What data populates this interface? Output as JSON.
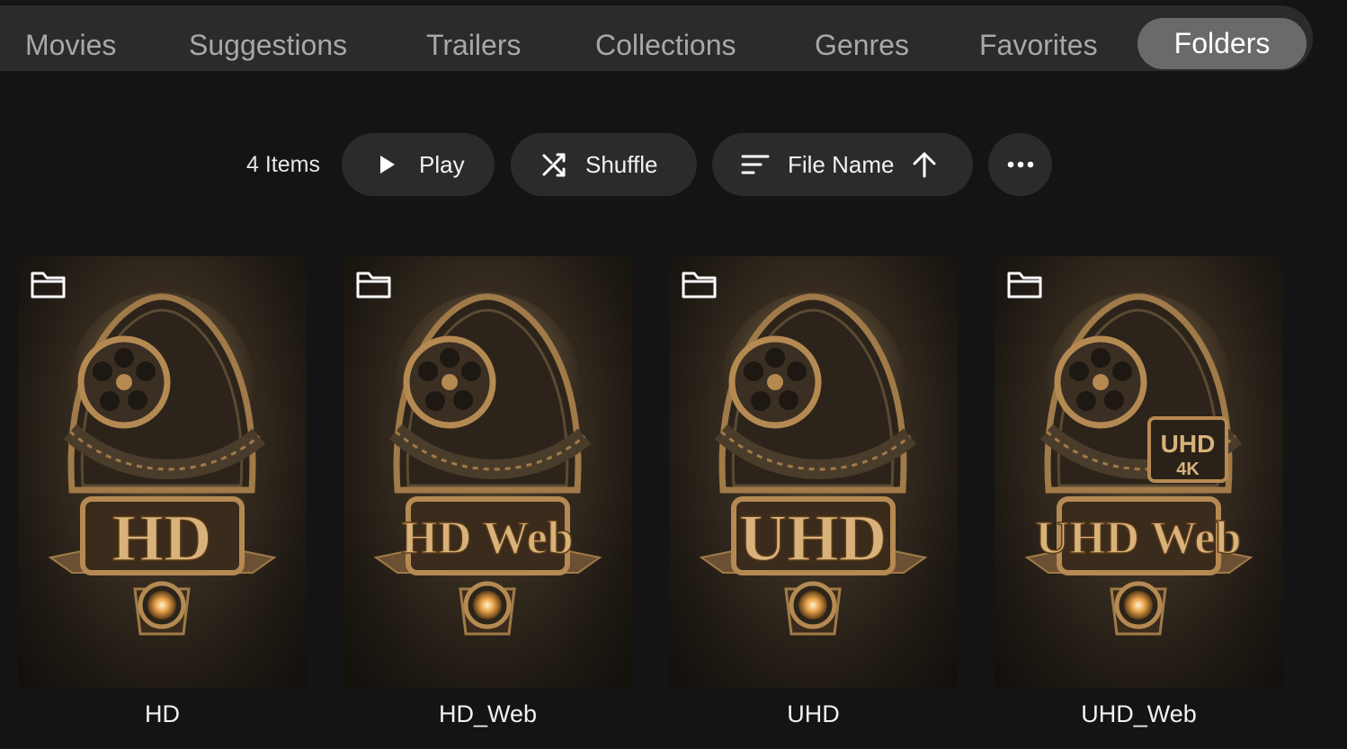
{
  "tabs": [
    {
      "label": "Movies",
      "active": false
    },
    {
      "label": "Suggestions",
      "active": false
    },
    {
      "label": "Trailers",
      "active": false
    },
    {
      "label": "Collections",
      "active": false
    },
    {
      "label": "Genres",
      "active": false
    },
    {
      "label": "Favorites",
      "active": false
    },
    {
      "label": "Folders",
      "active": true
    }
  ],
  "toolbar": {
    "item_count": "4 Items",
    "play_label": "Play",
    "play_icon": "play-icon",
    "shuffle_label": "Shuffle",
    "shuffle_icon": "shuffle-icon",
    "sort_label": "File Name",
    "sort_icon": "sort-lines-icon",
    "sort_direction_icon": "arrow-up-icon",
    "more_icon": "more-horizontal-icon"
  },
  "folders": [
    {
      "title": "HD",
      "badge": "HD",
      "icon": "folder-icon"
    },
    {
      "title": "HD_Web",
      "badge": "HD Web",
      "icon": "folder-icon"
    },
    {
      "title": "UHD",
      "badge": "UHD",
      "icon": "folder-icon"
    },
    {
      "title": "UHD_Web",
      "badge": "UHD Web",
      "badge_sub": "UHD",
      "badge_sub2": "4K",
      "icon": "folder-icon"
    }
  ],
  "colors": {
    "background": "#141414",
    "tabbar": "#2b2b2b",
    "active_tab": "#6a6a6a",
    "button": "#2b2b2b",
    "bronze": "#b58a52"
  }
}
